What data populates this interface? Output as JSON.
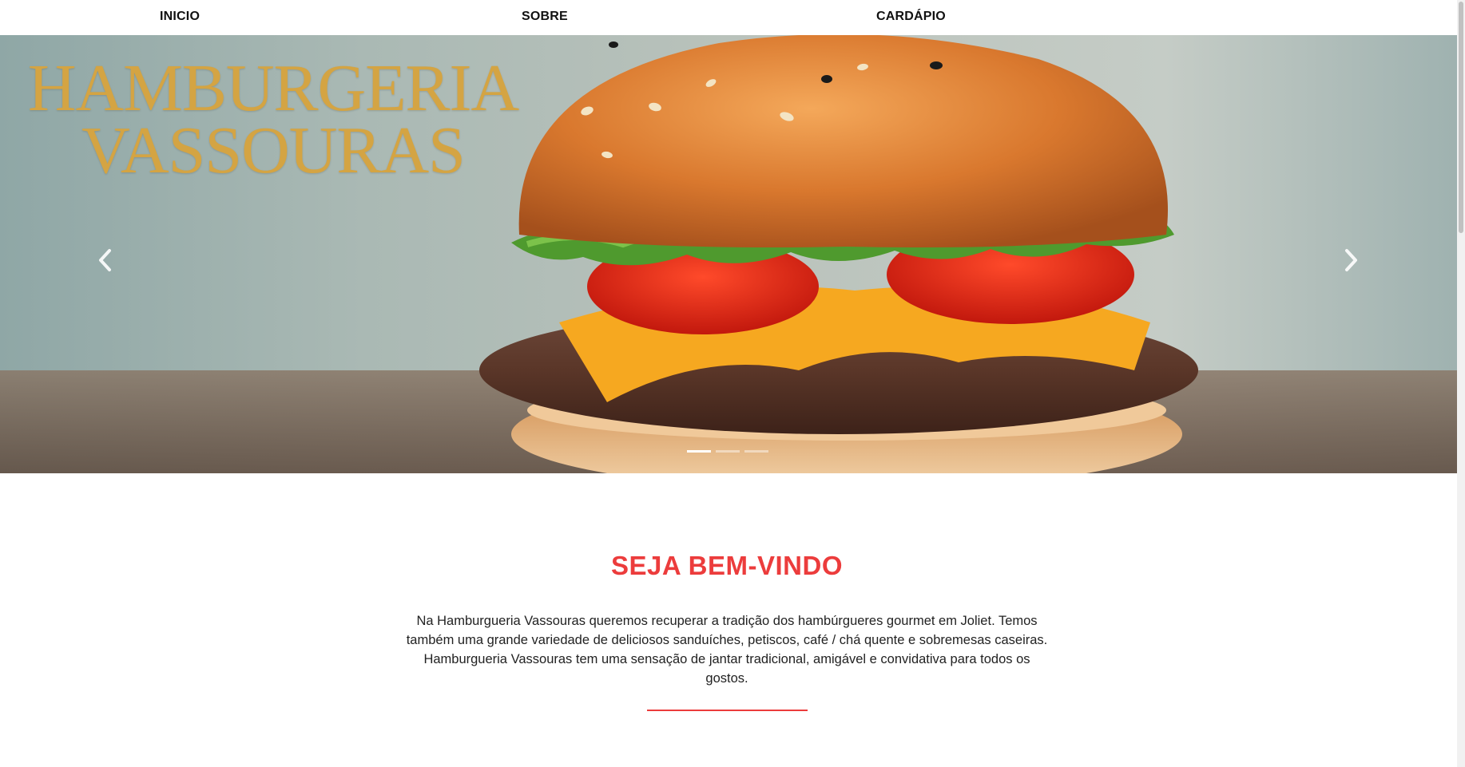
{
  "nav": {
    "items": [
      {
        "label": "INICIO"
      },
      {
        "label": "SOBRE"
      },
      {
        "label": "CARDÁPIO"
      }
    ]
  },
  "hero": {
    "title_line1": "HAMBURGERIA",
    "title_line2": "VASSOURAS",
    "prev_icon": "chevron-left-icon",
    "next_icon": "chevron-right-icon",
    "slides_count": 3,
    "active_slide": 1
  },
  "welcome": {
    "title": "SEJA BEM-VINDO",
    "text": "Na Hamburgueria Vassouras queremos recuperar a tradição dos hambúrgueres gourmet em Joliet. Temos também uma grande variedade de deliciosos sanduíches, petiscos, café / chá quente e sobremesas caseiras. Hamburgueria Vassouras tem uma sensação de jantar tradicional, amigável e convidativa para todos os gostos."
  },
  "colors": {
    "accent": "#ec3c3c",
    "hero_title": "#d4a443"
  }
}
